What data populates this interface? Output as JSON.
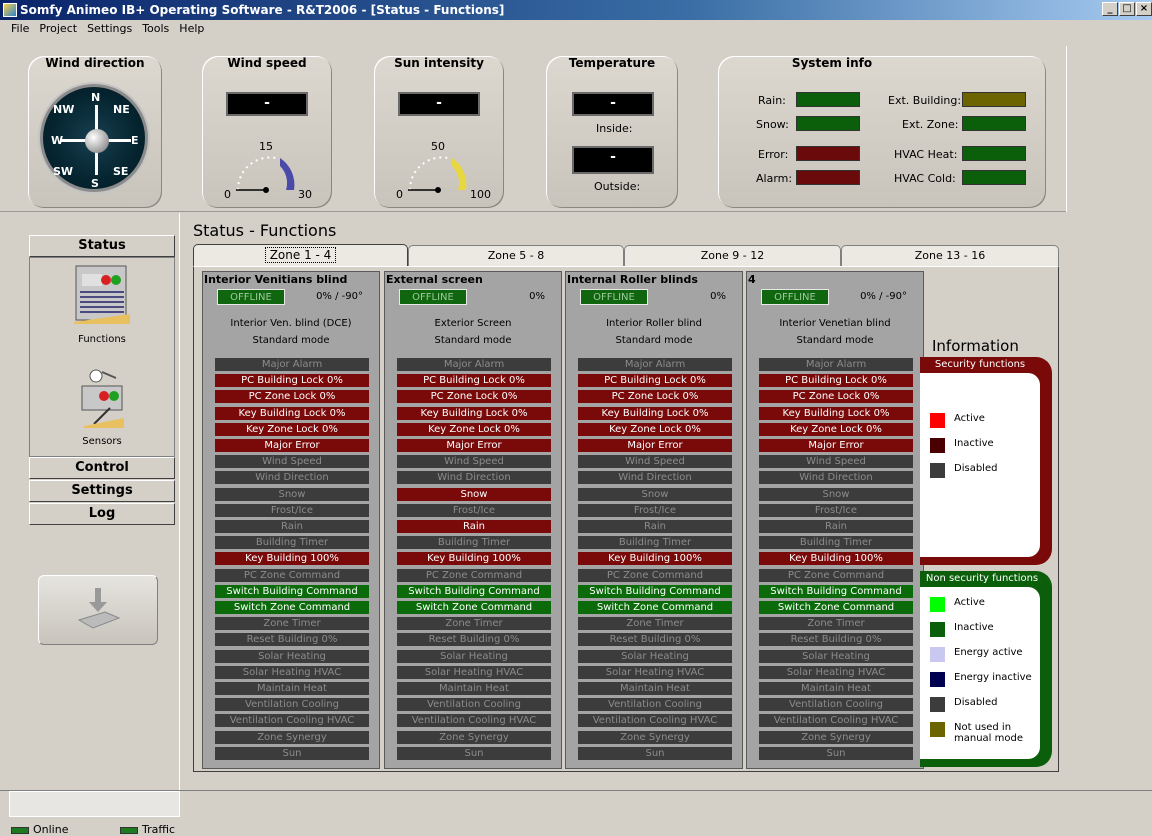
{
  "window": {
    "title": "Somfy Animeo IB+ Operating Software - R&T2006 - [Status - Functions]",
    "buttons": [
      "_",
      "□",
      "×"
    ]
  },
  "menu": [
    "File",
    "Project",
    "Settings",
    "Tools",
    "Help"
  ],
  "top": {
    "wind_direction": {
      "title": "Wind direction",
      "dirs": [
        "N",
        "NE",
        "E",
        "SE",
        "S",
        "SW",
        "W",
        "NW"
      ]
    },
    "wind_speed": {
      "title": "Wind speed",
      "display": "-",
      "scale_mid": "15",
      "scale_min": "0",
      "scale_max": "30"
    },
    "sun": {
      "title": "Sun intensity",
      "display": "-",
      "scale_mid": "50",
      "scale_min": "0",
      "scale_max": "100"
    },
    "temperature": {
      "title": "Temperature",
      "inside_display": "-",
      "inside_label": "Inside:",
      "outside_display": "-",
      "outside_label": "Outside:"
    },
    "system": {
      "title": "System info",
      "items": [
        {
          "label": "Rain:",
          "color": "#0b5f0b"
        },
        {
          "label": "Snow:",
          "color": "#0b5f0b"
        },
        {
          "label": "Error:",
          "color": "#6b0a0a"
        },
        {
          "label": "Alarm:",
          "color": "#6b0a0a"
        },
        {
          "label": "Ext. Building:",
          "color": "#6b6400"
        },
        {
          "label": "Ext. Zone:",
          "color": "#0b5f0b"
        },
        {
          "label": "HVAC Heat:",
          "color": "#0b5f0b"
        },
        {
          "label": "HVAC Cold:",
          "color": "#0b5f0b"
        }
      ]
    }
  },
  "sidebar": {
    "status": "Status",
    "functions": "Functions",
    "sensors": "Sensors",
    "control": "Control",
    "settings": "Settings",
    "log": "Log"
  },
  "statusbar": {
    "online": "Online",
    "traffic": "Traffic"
  },
  "content": {
    "title": "Status - Functions",
    "tabs": [
      "Zone 1 - 4",
      "Zone 5 - 8",
      "Zone 9 - 12",
      "Zone 13 - 16"
    ],
    "functions": [
      "Major Alarm",
      "PC Building Lock 0%",
      "PC Zone Lock 0%",
      "Key Building Lock 0%",
      "Key Zone Lock 0%",
      "Major Error",
      "Wind Speed",
      "Wind Direction",
      "Snow",
      "Frost/Ice",
      "Rain",
      "Building Timer",
      "Key Building 100%",
      "PC Zone Command",
      "Switch Building Command",
      "Switch Zone Command",
      "Zone Timer",
      "Reset Building 0%",
      "Solar Heating",
      "Solar Heating HVAC",
      "Maintain Heat",
      "Ventilation Cooling",
      "Ventilation Cooling HVAC",
      "Zone Synergy",
      "Sun"
    ],
    "zones": [
      {
        "name": "Interior Venitians blind",
        "status": "OFFLINE",
        "position": "0% / -90°",
        "type": "Interior Ven. blind (DCE)",
        "mode": "Standard mode",
        "states": [
          "d",
          "r",
          "r",
          "r",
          "r",
          "r",
          "d",
          "d",
          "d",
          "d",
          "d",
          "d",
          "r",
          "d",
          "g",
          "g",
          "d",
          "d",
          "d",
          "d",
          "d",
          "d",
          "d",
          "d",
          "d"
        ]
      },
      {
        "name": "External screen",
        "status": "OFFLINE",
        "position": "0%",
        "type": "Exterior Screen",
        "mode": "Standard mode",
        "states": [
          "d",
          "r",
          "r",
          "r",
          "r",
          "r",
          "d",
          "d",
          "r",
          "d",
          "r",
          "d",
          "r",
          "d",
          "g",
          "g",
          "d",
          "d",
          "d",
          "d",
          "d",
          "d",
          "d",
          "d",
          "d"
        ]
      },
      {
        "name": "Internal Roller blinds",
        "status": "OFFLINE",
        "position": "0%",
        "type": "Interior Roller blind",
        "mode": "Standard mode",
        "states": [
          "d",
          "r",
          "r",
          "r",
          "r",
          "r",
          "d",
          "d",
          "d",
          "d",
          "d",
          "d",
          "r",
          "d",
          "g",
          "g",
          "d",
          "d",
          "d",
          "d",
          "d",
          "d",
          "d",
          "d",
          "d"
        ]
      },
      {
        "name": "4",
        "status": "OFFLINE",
        "position": "0% / -90°",
        "type": "Interior Venetian blind",
        "mode": "Standard mode",
        "states": [
          "d",
          "r",
          "r",
          "r",
          "r",
          "r",
          "d",
          "d",
          "d",
          "d",
          "d",
          "d",
          "r",
          "d",
          "g",
          "g",
          "d",
          "d",
          "d",
          "d",
          "d",
          "d",
          "d",
          "d",
          "d"
        ]
      }
    ],
    "info": {
      "title": "Information",
      "security_title": "Security functions",
      "security": [
        {
          "label": "Active",
          "color": "#ff0000"
        },
        {
          "label": "Inactive",
          "color": "#4a0000"
        },
        {
          "label": "Disabled",
          "color": "#3c3c3c"
        }
      ],
      "nonsecurity_title": "Non security functions",
      "nonsecurity": [
        {
          "label": "Active",
          "color": "#00ff00"
        },
        {
          "label": "Inactive",
          "color": "#0b5f0b"
        },
        {
          "label": "Energy active",
          "color": "#c8c8f0"
        },
        {
          "label": "Energy inactive",
          "color": "#000050"
        },
        {
          "label": "Disabled",
          "color": "#3c3c3c"
        },
        {
          "label": "Not used in manual mode",
          "color": "#6b6400"
        }
      ]
    }
  }
}
